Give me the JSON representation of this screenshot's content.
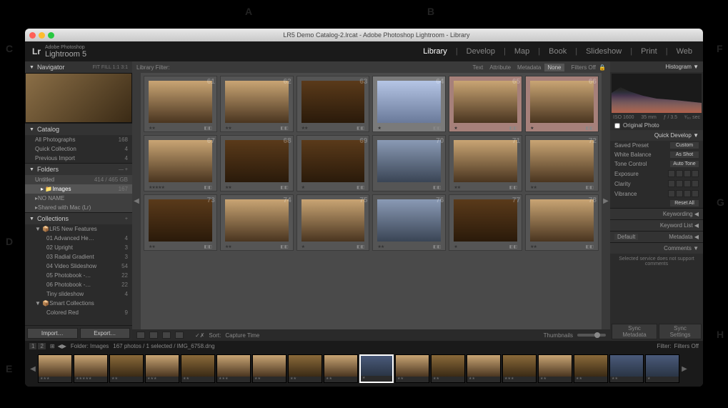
{
  "callouts": {
    "a": "A",
    "b": "B",
    "c": "C",
    "d": "D",
    "e": "E",
    "f": "F",
    "g": "G",
    "h": "H"
  },
  "titlebar": {
    "title": "LR5 Demo Catalog-2.lrcat - Adobe Photoshop Lightroom - Library"
  },
  "header": {
    "logo": "Lr",
    "brand_top": "Adobe Photoshop",
    "brand": "Lightroom 5"
  },
  "modules": {
    "library": "Library",
    "develop": "Develop",
    "map": "Map",
    "book": "Book",
    "slideshow": "Slideshow",
    "print": "Print",
    "web": "Web"
  },
  "navigator": {
    "title": "Navigator",
    "modes": "FIT  FILL  1:1  3:1"
  },
  "catalog": {
    "title": "Catalog",
    "items": [
      {
        "label": "All Photographs",
        "count": "168"
      },
      {
        "label": "Quick Collection",
        "count": "4"
      },
      {
        "label": "Previous Import",
        "count": "4"
      }
    ]
  },
  "folders": {
    "title": "Folders",
    "volume": {
      "name": "Untitled",
      "info": "414 / 465 GB"
    },
    "items": [
      {
        "label": "Images",
        "count": "167"
      }
    ],
    "extras": [
      {
        "label": "NO NAME"
      },
      {
        "label": "Shared with Mac (Lr)"
      }
    ]
  },
  "collections": {
    "title": "Collections",
    "set": "LR5 New Features",
    "items": [
      {
        "label": "01 Advanced He…",
        "count": "4"
      },
      {
        "label": "02 Upright",
        "count": "3"
      },
      {
        "label": "03 Radial Gradient",
        "count": "3"
      },
      {
        "label": "04 Video Slideshow",
        "count": "54"
      },
      {
        "label": "05 Photobook -…",
        "count": "22"
      },
      {
        "label": "06 Photobook -…",
        "count": "22"
      },
      {
        "label": "Tiny slideshow",
        "count": "4"
      }
    ],
    "smart": "Smart Collections",
    "smart_items": [
      {
        "label": "Colored Red",
        "count": "9"
      }
    ]
  },
  "buttons": {
    "import": "Import…",
    "export": "Export…"
  },
  "filter": {
    "label": "Library Filter:",
    "text": "Text",
    "attribute": "Attribute",
    "metadata": "Metadata",
    "none": "None",
    "off": "Filters Off"
  },
  "grid": {
    "rows": [
      {
        "start": 61,
        "cells": [
          {
            "n": "61"
          },
          {
            "n": "62"
          },
          {
            "n": "63"
          },
          {
            "n": "64",
            "sel": true
          },
          {
            "n": "65",
            "flag": true
          },
          {
            "n": "66",
            "flag": true
          }
        ]
      },
      {
        "start": 67,
        "cells": [
          {
            "n": "67"
          },
          {
            "n": "68"
          },
          {
            "n": "69"
          },
          {
            "n": "70"
          },
          {
            "n": "71"
          },
          {
            "n": "72"
          }
        ]
      },
      {
        "start": 73,
        "cells": [
          {
            "n": "73"
          },
          {
            "n": "74"
          },
          {
            "n": "75"
          },
          {
            "n": "76"
          },
          {
            "n": "77"
          },
          {
            "n": "78"
          }
        ]
      }
    ]
  },
  "toolbar": {
    "sort_label": "Sort:",
    "sort_value": "Capture Time",
    "thumbnails": "Thumbnails"
  },
  "histogram": {
    "title": "Histogram",
    "iso": "ISO 1600",
    "focal": "35 mm",
    "aperture": "ƒ / 3.5",
    "shutter": "¹⁄₆₀ sec",
    "original": "Original Photo"
  },
  "quickdev": {
    "title": "Quick Develop",
    "preset": {
      "label": "Saved Preset",
      "value": "Custom"
    },
    "wb": {
      "label": "White Balance",
      "value": "As Shot"
    },
    "tone": {
      "label": "Tone Control",
      "value": "Auto Tone"
    },
    "exposure": "Exposure",
    "clarity": "Clarity",
    "vibrance": "Vibrance",
    "reset": "Reset All"
  },
  "right_collapsed": {
    "keywording": "Keywording",
    "keywordlist": "Keyword List",
    "metadata": "Metadata",
    "metadata_preset": "Default",
    "comments": "Comments",
    "comments_msg": "Selected service does not support comments"
  },
  "status": {
    "folder": "Folder: Images",
    "count": "167 photos / 1 selected / IMG_6758.dng",
    "sync_meta": "Sync Metadata",
    "sync_settings": "Sync Settings"
  },
  "filmstrip": {
    "badge1": "1",
    "badge2": "2",
    "filter": "Filter:",
    "filters_off": "Filters Off"
  }
}
